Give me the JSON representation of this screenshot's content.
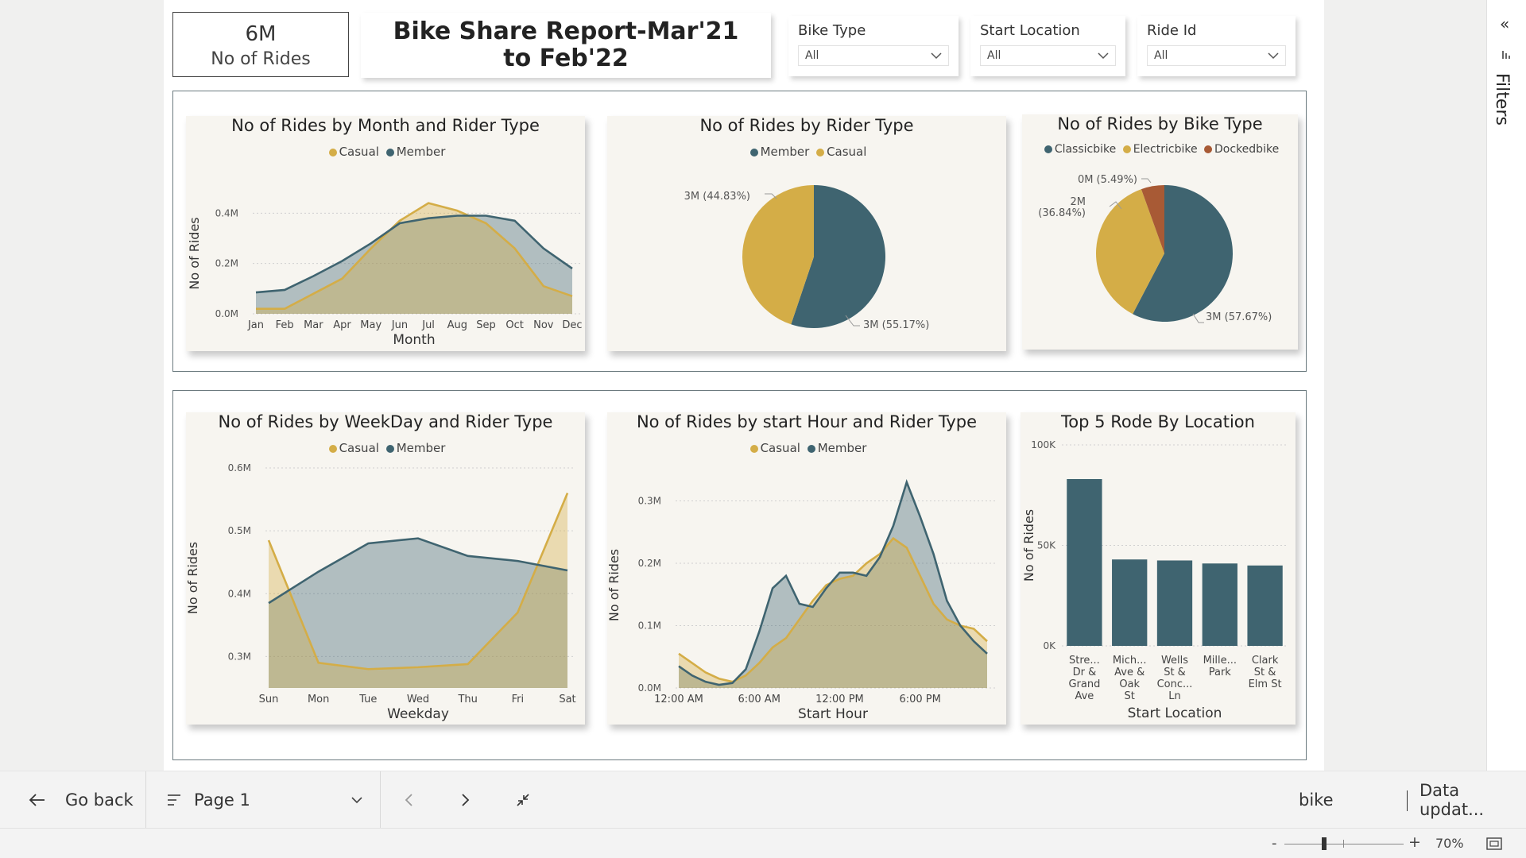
{
  "kpi": {
    "value": "6M",
    "label": "No of Rides"
  },
  "report_title": "Bike Share Report-Mar'21 to Feb'22",
  "slicers": [
    {
      "title": "Bike Type",
      "value": "All"
    },
    {
      "title": "Start Location",
      "value": "All"
    },
    {
      "title": "Ride Id",
      "value": "All"
    }
  ],
  "colors": {
    "casual": "#d4ad47",
    "member": "#3f6470",
    "docked": "#a85a35"
  },
  "chart_data": [
    {
      "type": "area",
      "title": "No of Rides by Month and Rider Type",
      "legend": [
        "Casual",
        "Member"
      ],
      "xlabel": "Month",
      "ylabel": "No of Rides",
      "categories": [
        "Jan",
        "Feb",
        "Mar",
        "Apr",
        "May",
        "Jun",
        "Jul",
        "Aug",
        "Sep",
        "Oct",
        "Nov",
        "Dec"
      ],
      "yticks": [
        "0.0M",
        "0.2M",
        "0.4M"
      ],
      "ylim": [
        0,
        0.48
      ],
      "series": [
        {
          "name": "Casual",
          "values": [
            0.02,
            0.02,
            0.08,
            0.14,
            0.26,
            0.37,
            0.44,
            0.41,
            0.36,
            0.26,
            0.11,
            0.07
          ]
        },
        {
          "name": "Member",
          "values": [
            0.085,
            0.095,
            0.15,
            0.21,
            0.28,
            0.36,
            0.38,
            0.39,
            0.39,
            0.37,
            0.26,
            0.18
          ]
        }
      ]
    },
    {
      "type": "pie",
      "title": "No of Rides by Rider Type",
      "legend": [
        "Member",
        "Casual"
      ],
      "slices": [
        {
          "name": "Member",
          "value": 55.17,
          "label": "3M (55.17%)"
        },
        {
          "name": "Casual",
          "value": 44.83,
          "label": "3M (44.83%)"
        }
      ]
    },
    {
      "type": "pie",
      "title": "No of Rides by Bike Type",
      "legend": [
        "Classicbike",
        "Electricbike",
        "Dockedbike"
      ],
      "slices": [
        {
          "name": "Classicbike",
          "value": 57.67,
          "label": "3M (57.67%)"
        },
        {
          "name": "Electricbike",
          "value": 36.84,
          "label": "2M (36.84%)"
        },
        {
          "name": "Dockedbike",
          "value": 5.49,
          "label": "0M (5.49%)"
        }
      ]
    },
    {
      "type": "area",
      "title": "No of Rides by WeekDay and Rider Type",
      "legend": [
        "Casual",
        "Member"
      ],
      "xlabel": "Weekday",
      "ylabel": "No of Rides",
      "categories": [
        "Sun",
        "Mon",
        "Tue",
        "Wed",
        "Thu",
        "Fri",
        "Sat"
      ],
      "yticks": [
        "0.3M",
        "0.4M",
        "0.5M",
        "0.6M"
      ],
      "ylim": [
        0.25,
        0.6
      ],
      "series": [
        {
          "name": "Casual",
          "values": [
            0.485,
            0.29,
            0.28,
            0.283,
            0.288,
            0.37,
            0.56
          ]
        },
        {
          "name": "Member",
          "values": [
            0.385,
            0.435,
            0.48,
            0.488,
            0.46,
            0.452,
            0.437
          ]
        }
      ]
    },
    {
      "type": "area",
      "title": "No of Rides by start Hour and Rider Type",
      "legend": [
        "Casual",
        "Member"
      ],
      "xlabel": "Start Hour",
      "ylabel": "No of Rides",
      "xticks": [
        "12:00 AM",
        "6:00 AM",
        "12:00 PM",
        "6:00 PM"
      ],
      "yticks": [
        "0.0M",
        "0.1M",
        "0.2M",
        "0.3M"
      ],
      "ylim": [
        0,
        0.33
      ],
      "x": [
        0,
        1,
        2,
        3,
        4,
        5,
        6,
        7,
        8,
        9,
        10,
        11,
        12,
        13,
        14,
        15,
        16,
        17,
        18,
        19,
        20,
        21,
        22,
        23
      ],
      "series": [
        {
          "name": "Casual",
          "values": [
            0.055,
            0.04,
            0.025,
            0.015,
            0.01,
            0.02,
            0.04,
            0.065,
            0.08,
            0.11,
            0.14,
            0.165,
            0.175,
            0.18,
            0.2,
            0.215,
            0.24,
            0.225,
            0.18,
            0.135,
            0.11,
            0.1,
            0.095,
            0.075
          ]
        },
        {
          "name": "Member",
          "values": [
            0.035,
            0.02,
            0.01,
            0.005,
            0.008,
            0.03,
            0.09,
            0.16,
            0.18,
            0.135,
            0.13,
            0.16,
            0.185,
            0.185,
            0.18,
            0.21,
            0.26,
            0.33,
            0.275,
            0.215,
            0.14,
            0.1,
            0.075,
            0.055
          ]
        }
      ]
    },
    {
      "type": "bar",
      "title": "Top 5 Rode By Location",
      "xlabel": "Start Location",
      "ylabel": "No of Rides",
      "yticks": [
        "0K",
        "50K",
        "100K"
      ],
      "ylim": [
        0,
        100
      ],
      "categories": [
        [
          "Stre...",
          "Dr &",
          "Grand",
          "Ave"
        ],
        [
          "Mich...",
          "Ave &",
          "Oak",
          "St"
        ],
        [
          "Wells",
          "St &",
          "Conc...",
          "Ln"
        ],
        [
          "Mille...",
          "Park"
        ],
        [
          "Clark",
          "St &",
          "Elm St"
        ]
      ],
      "values": [
        83,
        43,
        42.5,
        41,
        40
      ]
    }
  ],
  "filters_pane": {
    "label": "Filters"
  },
  "navigation": {
    "go_back": "Go back",
    "page": "Page 1",
    "search_text": "bike",
    "data_updated": "Data updat..."
  },
  "zoom": {
    "minus": "-",
    "plus": "+",
    "level": "70%",
    "value": 70
  }
}
